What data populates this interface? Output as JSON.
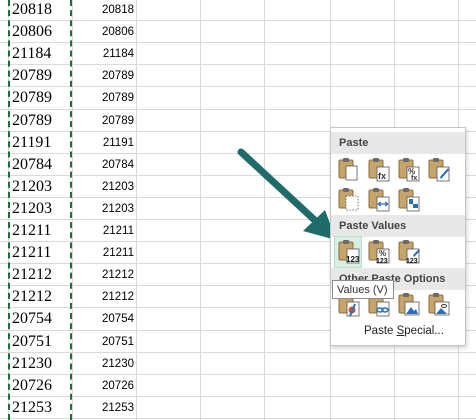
{
  "worksheet": {
    "column_a_values": [
      "20818",
      "20806",
      "21184",
      "20789",
      "20789",
      "20789",
      "21191",
      "20784",
      "21203",
      "21203",
      "21211",
      "21211",
      "21212",
      "21212",
      "20754",
      "20751",
      "21230",
      "20726",
      "21253"
    ],
    "column_b_values": [
      "20818",
      "20806",
      "21184",
      "20789",
      "20789",
      "20789",
      "21191",
      "20784",
      "21203",
      "21203",
      "21211",
      "21211",
      "21212",
      "21212",
      "20754",
      "20751",
      "21230",
      "20726",
      "21253"
    ]
  },
  "paste_menu": {
    "paste_header": "Paste",
    "paste_values_header": "Paste Values",
    "other_header": "Other Paste Options",
    "paste_special_prefix": "Paste ",
    "paste_special_accel": "S",
    "paste_special_suffix": "pecial...",
    "tooltip": "Values (V)",
    "paste_icons": [
      "paste-icon",
      "paste-formulas-icon",
      "paste-formulas-number-format-icon",
      "keep-source-formatting-icon",
      "no-borders-icon",
      "keep-column-widths-icon",
      "transpose-icon"
    ],
    "values_icons": [
      "paste-values-icon",
      "paste-values-number-format-icon",
      "paste-values-source-format-icon"
    ],
    "other_icons": [
      "paste-formatting-icon",
      "paste-link-icon",
      "paste-picture-icon",
      "linked-picture-icon"
    ],
    "icon_badges": {
      "formulas": "fx",
      "number": "%",
      "values": "123"
    }
  },
  "colors": {
    "accent_green": "#1e6e3c",
    "arrow_teal": "#1e6b6a",
    "clipboard_tan": "#c7a46a",
    "hover_green": "#d9efe4"
  }
}
